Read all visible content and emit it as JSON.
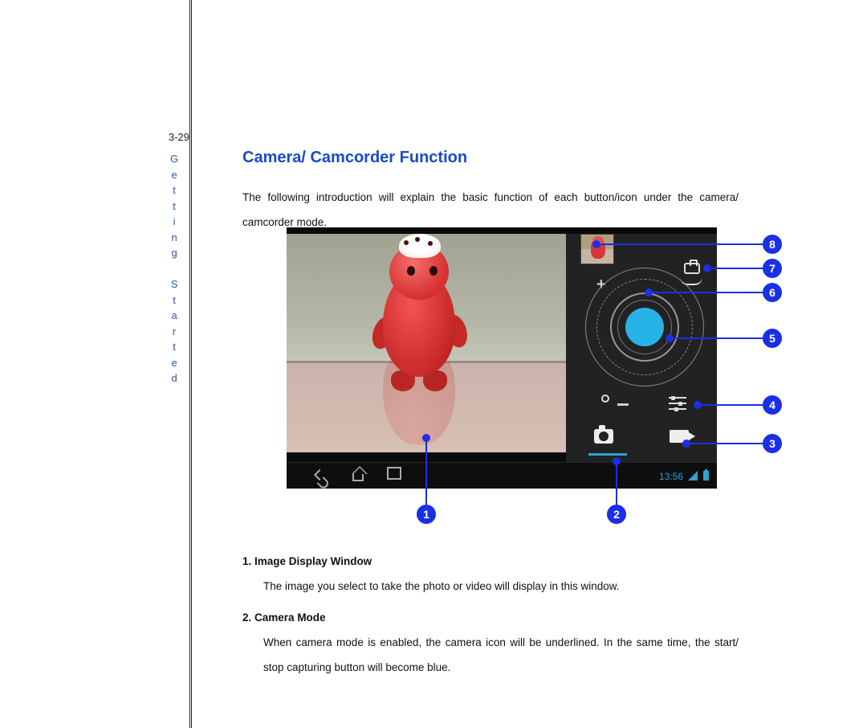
{
  "page": {
    "number": "3-29",
    "side_label": "Getting Started",
    "title": "Camera/ Camcorder Function",
    "intro": "The following introduction will explain the basic function of each button/icon under the camera/ camcorder mode."
  },
  "screenshot": {
    "status_time": "13:56",
    "icons": {
      "switch_camera": "switch-camera-icon",
      "zoom_plus": "+",
      "zoom_minus": "−",
      "exposure_ring": "○",
      "sliders": "settings-sliders-icon",
      "camera_mode": "camera-icon",
      "video_mode": "camcorder-icon",
      "nav_back": "back-icon",
      "nav_home": "home-icon",
      "nav_recent": "recent-apps-icon"
    }
  },
  "callouts": {
    "c1": "1",
    "c2": "2",
    "c3": "3",
    "c4": "4",
    "c5": "5",
    "c6": "6",
    "c7": "7",
    "c8": "8"
  },
  "items": [
    {
      "num": "1.",
      "title": "Image Display Window",
      "body": "The image you select to take the photo or video will display in this window."
    },
    {
      "num": "2.",
      "title": "Camera Mode",
      "body": "When camera mode is enabled, the camera icon will be underlined. In the same time, the start/ stop capturing button will become blue."
    }
  ]
}
